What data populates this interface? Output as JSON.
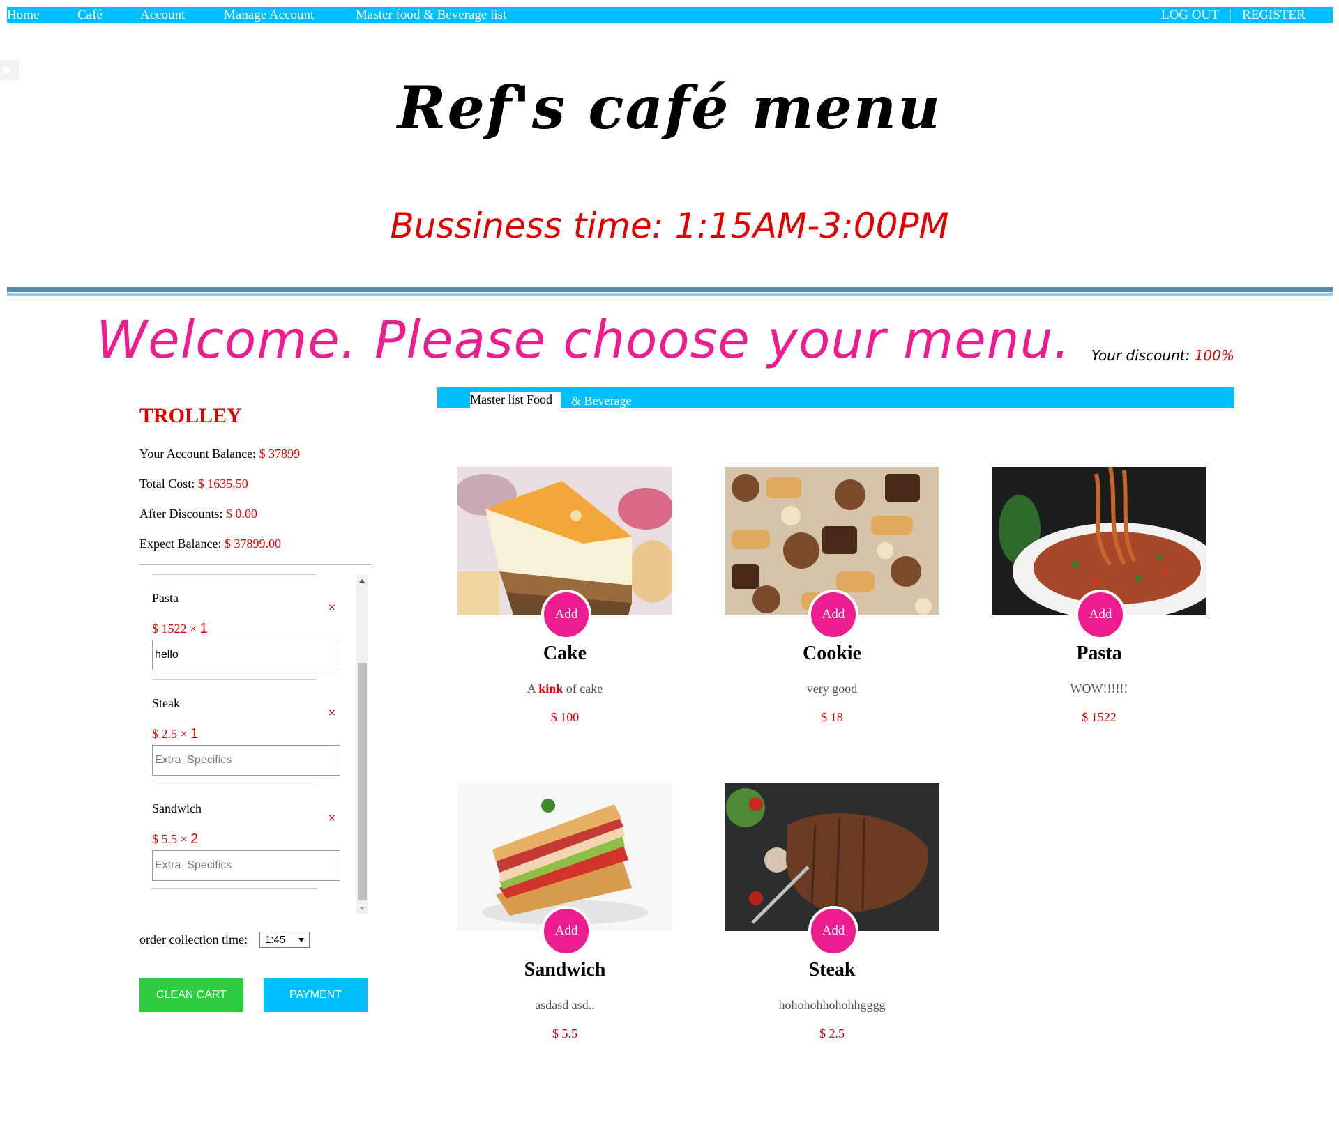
{
  "nav": {
    "left": [
      "Home",
      "Café",
      "Account",
      "Manage Account",
      "Master food & Beverage list"
    ],
    "logout": "LOG OUT",
    "separator": "|",
    "register": "REGISTER"
  },
  "header": {
    "title": "Ref's café menu",
    "business_time": "Bussiness time: 1:15AM-3:00PM",
    "welcome": "Welcome. Please choose your menu.",
    "discount_label": "Your discount:",
    "discount_value": "100%"
  },
  "trolley": {
    "title": "TROLLEY",
    "balance_label": "Your Account Balance:",
    "balance_value": "$ 37899",
    "total_label": "Total Cost:",
    "total_value": "$ 1635.50",
    "after_label": "After Discounts:",
    "after_value": "$ 0.00",
    "expect_label": "Expect Balance:",
    "expect_value": "$ 37899.00",
    "remove_symbol": "×",
    "items": [
      {
        "name": "Pasta",
        "price": "$ 1522 ×",
        "qty": "1",
        "note_value": "hello",
        "note_placeholder": "Extra  Specifics"
      },
      {
        "name": "Steak",
        "price": "$ 2.5 ×",
        "qty": "1",
        "note_value": "",
        "note_placeholder": "Extra  Specifics"
      },
      {
        "name": "Sandwich",
        "price": "$ 5.5 ×",
        "qty": "2",
        "note_value": "",
        "note_placeholder": "Extra  Specifics"
      }
    ],
    "collection_label": "order collection time:",
    "collection_value": "1:45",
    "clean_button": "CLEAN CART",
    "payment_button": "PAYMENT"
  },
  "master": {
    "tab_left": "Master list Food",
    "tab_right": "&   Beverage",
    "add_label": "Add",
    "products": [
      {
        "name": "Cake",
        "desc_pre": "A ",
        "desc_bold": "kink",
        "desc_post": " of cake",
        "price": "$ 100",
        "icon": "cake-photo"
      },
      {
        "name": "Cookie",
        "desc_pre": "very good",
        "desc_bold": "",
        "desc_post": "",
        "price": "$ 18",
        "icon": "cookie-photo"
      },
      {
        "name": "Pasta",
        "desc_pre": "WOW!!!!!!",
        "desc_bold": "",
        "desc_post": "",
        "price": "$ 1522",
        "icon": "pasta-photo"
      },
      {
        "name": "Sandwich",
        "desc_pre": "asdasd asd..",
        "desc_bold": "",
        "desc_post": "",
        "price": "$ 5.5",
        "icon": "sandwich-photo"
      },
      {
        "name": "Steak",
        "desc_pre": "hohohohhohohhgggg",
        "desc_bold": "",
        "desc_post": "",
        "price": "$ 2.5",
        "icon": "steak-photo"
      }
    ]
  },
  "colors": {
    "nav_bg": "#00bfff",
    "accent_pink": "#ee1d8f",
    "price_red": "#e00000",
    "clean_green": "#2ecc40"
  }
}
